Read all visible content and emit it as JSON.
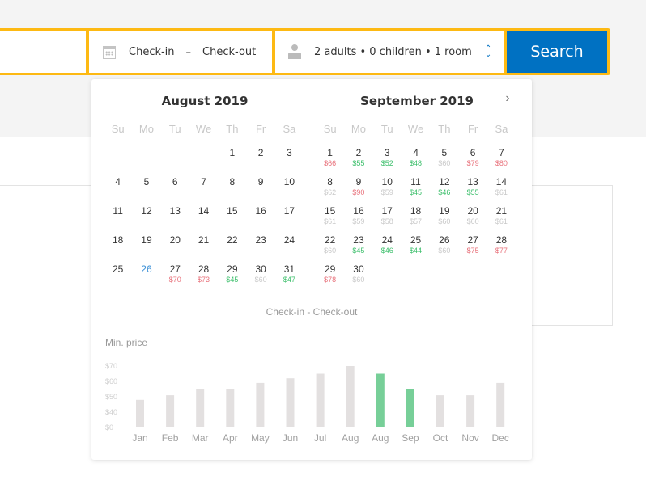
{
  "search": {
    "destination_value": "",
    "dates_checkin": "Check-in",
    "dates_separator": "–",
    "dates_checkout": "Check-out",
    "guests": "2 adults • 0 children • 1 room",
    "search_label": "Search",
    "accent_color": "#fdb913",
    "button_color": "#0071c2"
  },
  "calendar": {
    "next_label": "›",
    "weekdays": [
      "Su",
      "Mo",
      "Tu",
      "We",
      "Th",
      "Fr",
      "Sa"
    ],
    "months": [
      {
        "title": "August 2019",
        "start_offset": 4,
        "today": 26,
        "days": [
          {
            "d": "1"
          },
          {
            "d": "2"
          },
          {
            "d": "3"
          },
          {
            "d": "4"
          },
          {
            "d": "5"
          },
          {
            "d": "6"
          },
          {
            "d": "7"
          },
          {
            "d": "8"
          },
          {
            "d": "9"
          },
          {
            "d": "10"
          },
          {
            "d": "11"
          },
          {
            "d": "12"
          },
          {
            "d": "13"
          },
          {
            "d": "14"
          },
          {
            "d": "15"
          },
          {
            "d": "16"
          },
          {
            "d": "17"
          },
          {
            "d": "18"
          },
          {
            "d": "19"
          },
          {
            "d": "20"
          },
          {
            "d": "21"
          },
          {
            "d": "22"
          },
          {
            "d": "23"
          },
          {
            "d": "24"
          },
          {
            "d": "25"
          },
          {
            "d": "26"
          },
          {
            "d": "27",
            "p": "$70",
            "c": "high"
          },
          {
            "d": "28",
            "p": "$73",
            "c": "high"
          },
          {
            "d": "29",
            "p": "$45",
            "c": "low"
          },
          {
            "d": "30",
            "p": "$60",
            "c": "avg"
          },
          {
            "d": "31",
            "p": "$47",
            "c": "low"
          }
        ]
      },
      {
        "title": "September 2019",
        "start_offset": 0,
        "days": [
          {
            "d": "1",
            "p": "$66",
            "c": "high"
          },
          {
            "d": "2",
            "p": "$55",
            "c": "low"
          },
          {
            "d": "3",
            "p": "$52",
            "c": "low"
          },
          {
            "d": "4",
            "p": "$48",
            "c": "low"
          },
          {
            "d": "5",
            "p": "$60",
            "c": "avg"
          },
          {
            "d": "6",
            "p": "$79",
            "c": "high"
          },
          {
            "d": "7",
            "p": "$80",
            "c": "high"
          },
          {
            "d": "8",
            "p": "$62",
            "c": "avg"
          },
          {
            "d": "9",
            "p": "$90",
            "c": "high"
          },
          {
            "d": "10",
            "p": "$59",
            "c": "avg"
          },
          {
            "d": "11",
            "p": "$45",
            "c": "low"
          },
          {
            "d": "12",
            "p": "$46",
            "c": "low"
          },
          {
            "d": "13",
            "p": "$55",
            "c": "low"
          },
          {
            "d": "14",
            "p": "$61",
            "c": "avg"
          },
          {
            "d": "15",
            "p": "$61",
            "c": "avg"
          },
          {
            "d": "16",
            "p": "$59",
            "c": "avg"
          },
          {
            "d": "17",
            "p": "$58",
            "c": "avg"
          },
          {
            "d": "18",
            "p": "$57",
            "c": "avg"
          },
          {
            "d": "19",
            "p": "$60",
            "c": "avg"
          },
          {
            "d": "20",
            "p": "$60",
            "c": "avg"
          },
          {
            "d": "21",
            "p": "$61",
            "c": "avg"
          },
          {
            "d": "22",
            "p": "$60",
            "c": "avg"
          },
          {
            "d": "23",
            "p": "$45",
            "c": "low"
          },
          {
            "d": "24",
            "p": "$46",
            "c": "low"
          },
          {
            "d": "25",
            "p": "$44",
            "c": "low"
          },
          {
            "d": "26",
            "p": "$60",
            "c": "avg"
          },
          {
            "d": "27",
            "p": "$75",
            "c": "high"
          },
          {
            "d": "28",
            "p": "$77",
            "c": "high"
          },
          {
            "d": "29",
            "p": "$78",
            "c": "high"
          },
          {
            "d": "30",
            "p": "$60",
            "c": "avg"
          }
        ]
      }
    ],
    "price_colors": {
      "high": "#e8707a",
      "low": "#3cbf6b",
      "avg": "#c9c9c9",
      "today": "#3a8fd6"
    },
    "footer_label": "Check-in - Check-out",
    "min_price_label": "Min. price"
  },
  "chart_data": {
    "type": "bar",
    "title": "Min. price",
    "categories": [
      "Jan",
      "Feb",
      "Mar",
      "Apr",
      "May",
      "Jun",
      "Jul",
      "Aug",
      "Aug",
      "Sep",
      "Oct",
      "Nov",
      "Dec"
    ],
    "values": [
      48,
      51,
      55,
      55,
      59,
      62,
      65,
      70,
      65,
      55,
      51,
      51,
      59
    ],
    "highlighted": [
      false,
      false,
      false,
      false,
      false,
      false,
      false,
      false,
      true,
      true,
      false,
      false,
      false
    ],
    "yticks": [
      "$0",
      "$40",
      "$50",
      "$60",
      "$70"
    ],
    "ytick_values": [
      0,
      40,
      50,
      60,
      70
    ],
    "ylim": [
      0,
      70
    ],
    "bar_color": "#e3e0e0",
    "highlight_color": "#77cf98",
    "grid": false
  }
}
